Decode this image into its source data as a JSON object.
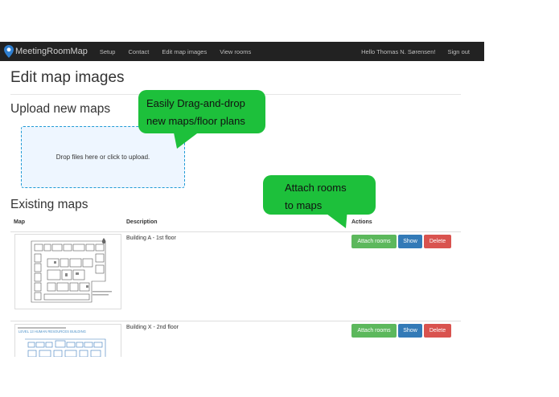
{
  "navbar": {
    "brand": "MeetingRoomMap",
    "links": [
      "Setup",
      "Contact",
      "Edit map images",
      "View rooms"
    ],
    "user_greeting": "Hello Thomas N. Sørensen!",
    "sign_out": "Sign out"
  },
  "page": {
    "title": "Edit map images",
    "upload_heading": "Upload new maps",
    "dropzone_text": "Drop files here or click to upload.",
    "existing_heading": "Existing maps"
  },
  "callouts": {
    "drag_drop": [
      "Easily Drag-and-drop",
      "new maps/floor plans"
    ],
    "attach": [
      "Attach rooms",
      "to maps"
    ]
  },
  "table": {
    "headers": {
      "map": "Map",
      "description": "Description",
      "actions": "Actions"
    },
    "rows": [
      {
        "description": "Building A - 1st floor"
      },
      {
        "description": "Building X - 2nd floor",
        "thumb_caption": "LEVEL 13 HUMAN RESOURCES BUILDING"
      }
    ],
    "actions": {
      "attach": "Attach rooms",
      "show": "Show",
      "delete": "Delete"
    }
  },
  "colors": {
    "navbar_bg": "#222222",
    "callout_green": "#1dc03b",
    "btn_green": "#5cb85c",
    "btn_blue": "#337ab7",
    "btn_red": "#d9534f",
    "dropzone_border": "#1f9ad6"
  }
}
